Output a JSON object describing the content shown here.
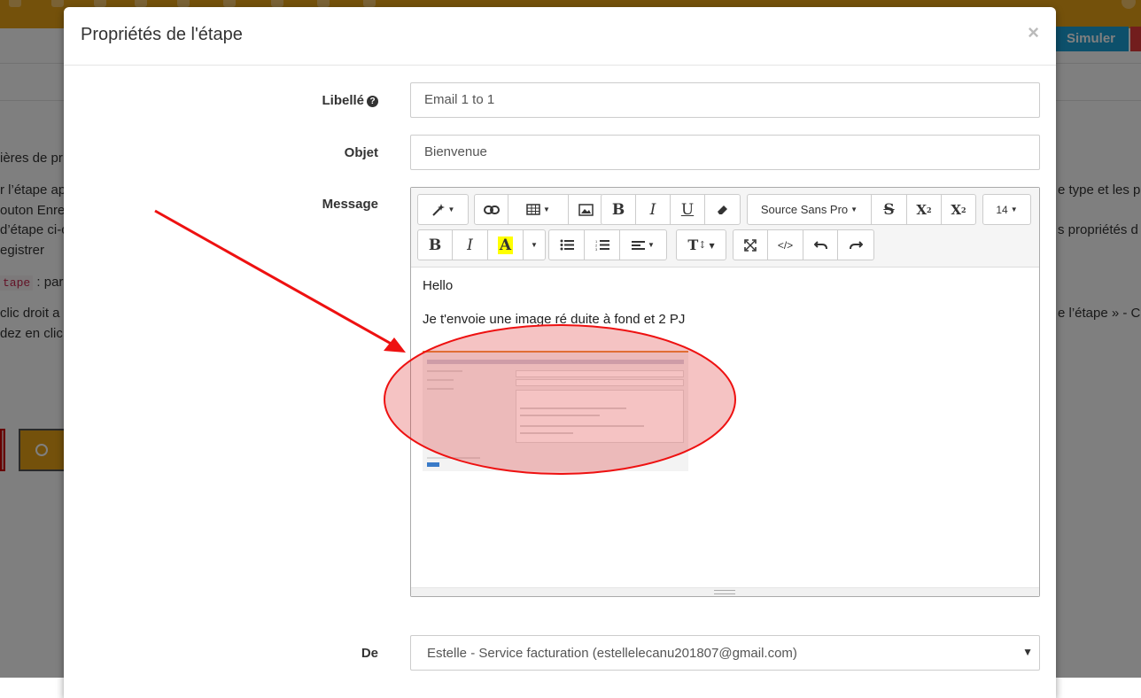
{
  "background": {
    "simulate_label": "Simuler",
    "fragments": [
      "ières de pr",
      "r l’étape ap",
      "outon Enre",
      "d’étape ci-c",
      "egistrer",
      "clic droit a",
      "dez en clic",
      "e type et les p",
      "s propriétés d",
      "e l’étape » - Co"
    ],
    "code_fragment": "tape",
    "code_suffix": ": par"
  },
  "modal": {
    "title": "Propriétés de l'étape",
    "close_label": "×",
    "label_field": {
      "label": "Libellé",
      "value": "Email 1 to 1"
    },
    "subject_field": {
      "label": "Objet",
      "value": "Bienvenue"
    },
    "message_label": "Message",
    "editor": {
      "font_name": "Source Sans Pro",
      "font_size": "14",
      "lines": [
        "Hello",
        "Je t'envoie une image ré duite à fond et 2 PJ"
      ]
    },
    "from_field": {
      "label": "De",
      "value": "Estelle - Service facturation (estellelecanu201807@gmail.com)"
    }
  },
  "colors": {
    "topbar": "#e8a317",
    "simulate_button": "#1ba1d6",
    "annotation": "#ee1111"
  }
}
